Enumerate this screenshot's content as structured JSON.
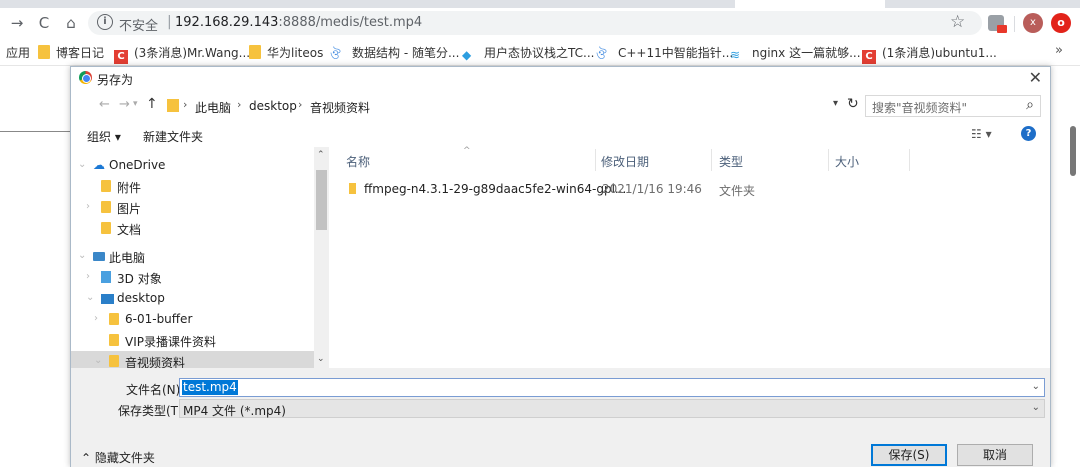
{
  "browser": {
    "nav": {
      "back_icon": "→",
      "reload_icon": "C",
      "home_icon": "⌂"
    },
    "omnibox": {
      "security_label": "不安全",
      "separator": "|",
      "url_host": "192.168.29.143",
      "url_path": ":8888/medis/test.mp4"
    },
    "avatar_letter": "x",
    "ext_letter": "o"
  },
  "bookmarks": {
    "apps_label": "应用",
    "items": [
      "博客日记",
      "(3条消息)Mr.Wang...",
      "华为liteos",
      "数据结构 - 随笔分...",
      "用户态协议栈之TC...",
      "C++11中智能指针...",
      "nginx 这一篇就够...",
      "(1条消息)ubuntu1..."
    ],
    "more": "»"
  },
  "dialog": {
    "title": "另存为",
    "close": "✕",
    "address": {
      "crumbs": [
        "此电脑",
        "desktop",
        "音视频资料"
      ],
      "search_placeholder": "搜索\"音视频资料\""
    },
    "commands": {
      "organize": "组织 ▾",
      "new_folder": "新建文件夹",
      "view": "☷ ▾",
      "help": "?"
    },
    "tree": [
      {
        "label": "OneDrive"
      },
      {
        "label": "附件"
      },
      {
        "label": "图片"
      },
      {
        "label": "文档"
      },
      {
        "label": "此电脑"
      },
      {
        "label": "3D 对象"
      },
      {
        "label": "desktop"
      },
      {
        "label": "6-01-buffer"
      },
      {
        "label": "VIP录播课件资料"
      },
      {
        "label": "音视频资料"
      }
    ],
    "columns": {
      "name": "名称",
      "modified": "修改日期",
      "type": "类型",
      "size": "大小"
    },
    "files": [
      {
        "name": "ffmpeg-n4.3.1-29-g89daac5fe2-win64-gpl...",
        "modified": "2021/1/16 19:46",
        "type": "文件夹",
        "size": ""
      }
    ],
    "filename_label": "文件名(N):",
    "filename_value": "test.mp4",
    "filetype_label": "保存类型(T):",
    "filetype_value": "MP4 文件 (*.mp4)",
    "hide_folders": "⌃ 隐藏文件夹",
    "save_button": "保存(S)",
    "cancel_button": "取消"
  }
}
